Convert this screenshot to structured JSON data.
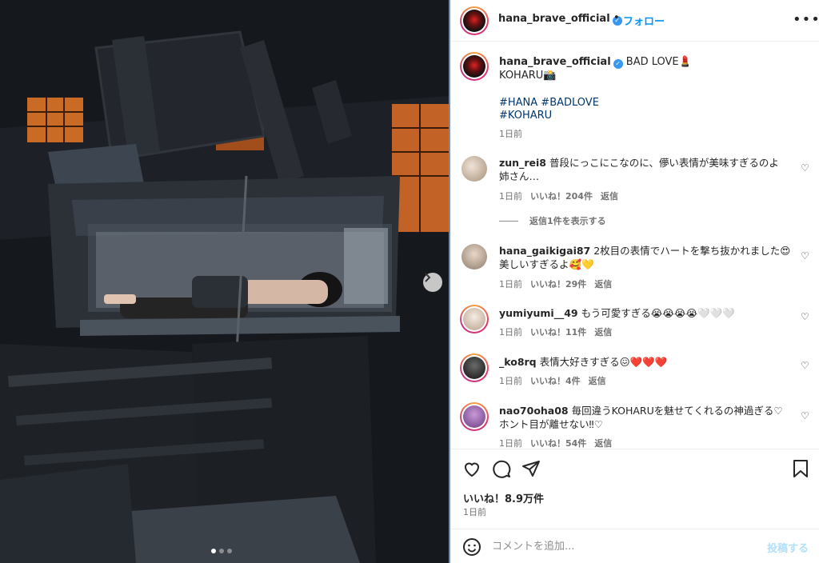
{
  "post": {
    "username": "hana_brave_official",
    "follow_label": "フォロー",
    "separator": "•",
    "more_icon": "more-horizontal-icon"
  },
  "caption": {
    "username": "hana_brave_official",
    "text": "BAD LOVE💄",
    "line2": "KOHARU📸",
    "hashtags_line1": "#HANA #BADLOVE",
    "hashtags_line2": "#KOHARU",
    "time": "1日前"
  },
  "comments": [
    {
      "username": "zun_rei8",
      "text": "普段にっこにこなのに、儚い表情が美味すぎるのよ",
      "text2": "姉さん…",
      "time": "1日前",
      "likes": "いいね！204件",
      "reply": "返信",
      "view_replies": "返信1件を表示する",
      "avatar_color": "#c9b8a6"
    },
    {
      "username": "hana_gaikigai87",
      "text": "2枚目の表情でハートを撃ち抜かれました😍",
      "text2": "美しいすぎるよ🥰💛",
      "time": "1日前",
      "likes": "いいね！29件",
      "reply": "返信",
      "avatar_color": "#b8a594"
    },
    {
      "username": "yumiyumi__49",
      "text": "もう可愛すぎる😭😭😭😭🤍🤍🤍",
      "time": "1日前",
      "likes": "いいね！11件",
      "reply": "返信",
      "avatar_color": "#d8c8b8"
    },
    {
      "username": "_ko8rq",
      "text": "表情大好きすぎる😖❤️❤️❤️",
      "time": "1日前",
      "likes": "いいね！4件",
      "reply": "返信",
      "avatar_color": "#3a3a3a"
    },
    {
      "username": "nao70oha08",
      "text": "毎回違うKOHARUを魅せてくれるの神過ぎる♡",
      "text2": "ホント目が離せない‼︎♡",
      "time": "1日前",
      "likes": "いいね！54件",
      "reply": "返信",
      "avatar_color": "#9a6cb0"
    }
  ],
  "actions": {
    "like_icon": "heart-icon",
    "comment_icon": "comment-icon",
    "share_icon": "share-icon",
    "save_icon": "bookmark-icon",
    "likes_count": "いいね！8.9万件",
    "date": "1日前"
  },
  "comment_input": {
    "placeholder": "コメントを追加...",
    "post_label": "投稿する",
    "emoji_icon": "emoji-icon"
  },
  "carousel": {
    "next_icon": "chevron-right-icon",
    "page_count": 3,
    "current_page": 1
  },
  "colors": {
    "link": "#0095f6",
    "hashtag": "#00376b",
    "muted": "#737373",
    "post_disabled": "#b2dffc"
  }
}
